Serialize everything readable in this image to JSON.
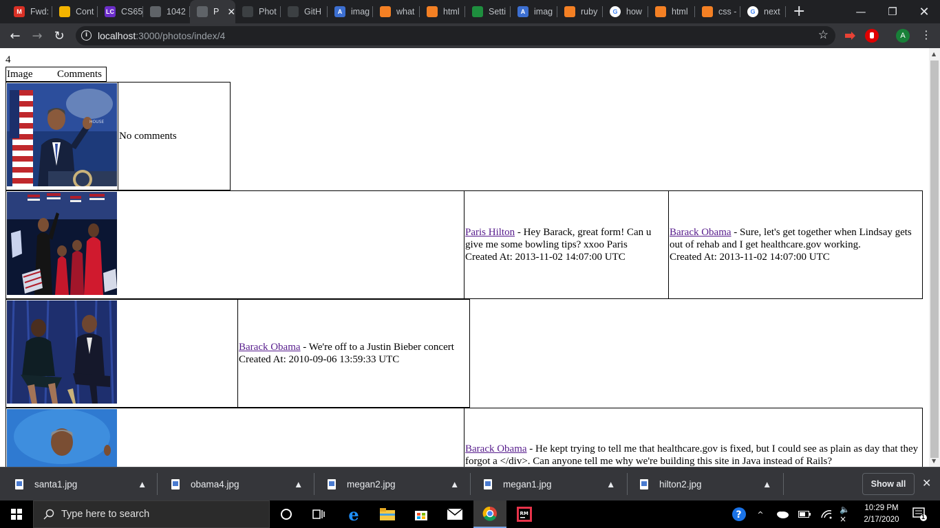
{
  "browser": {
    "tabs": [
      {
        "title": "Fwd:",
        "icon": "gmail-icon",
        "color": "#d93025",
        "glyph": "M",
        "active": false
      },
      {
        "title": "Cont",
        "icon": "doc-icon",
        "color": "#f4b400",
        "glyph": "",
        "active": false
      },
      {
        "title": "CS65",
        "icon": "lc-icon",
        "color": "#6b2dc9",
        "glyph": "LC",
        "active": false
      },
      {
        "title": "1042",
        "icon": "globe-icon",
        "color": "#5f6368",
        "glyph": "",
        "active": false
      },
      {
        "title": "P",
        "icon": "globe-icon",
        "color": "#5f6368",
        "glyph": "",
        "active": true
      },
      {
        "title": "Phot",
        "icon": "github-icon",
        "color": "#3c4043",
        "glyph": "",
        "active": false
      },
      {
        "title": "GitH",
        "icon": "github-icon",
        "color": "#3c4043",
        "glyph": "",
        "active": false
      },
      {
        "title": "imag",
        "icon": "a-icon",
        "color": "#3c6fd1",
        "glyph": "A",
        "active": false
      },
      {
        "title": "what",
        "icon": "stackoverflow-icon",
        "color": "#f48024",
        "glyph": "",
        "active": false
      },
      {
        "title": "html",
        "icon": "stackoverflow-icon",
        "color": "#f48024",
        "glyph": "",
        "active": false
      },
      {
        "title": "Setti",
        "icon": "settings-icon",
        "color": "#1e8e3e",
        "glyph": "",
        "active": false
      },
      {
        "title": "imag",
        "icon": "a-icon",
        "color": "#3c6fd1",
        "glyph": "A",
        "active": false
      },
      {
        "title": "ruby",
        "icon": "stackoverflow-icon",
        "color": "#f48024",
        "glyph": "",
        "active": false
      },
      {
        "title": "how",
        "icon": "google-icon",
        "color": "#ffffff",
        "glyph": "G",
        "active": false
      },
      {
        "title": "html",
        "icon": "stackoverflow-icon",
        "color": "#f48024",
        "glyph": "",
        "active": false
      },
      {
        "title": "css -",
        "icon": "stackoverflow-icon",
        "color": "#f48024",
        "glyph": "",
        "active": false
      },
      {
        "title": "next",
        "icon": "google-icon",
        "color": "#ffffff",
        "glyph": "G",
        "active": false
      }
    ],
    "url_host": "localhost",
    "url_path": ":3000/photos/index/4",
    "profile_initial": "A"
  },
  "page": {
    "photo_id": "4",
    "headers": {
      "image": "Image",
      "comments": "Comments"
    },
    "no_comments": "No comments",
    "rows": [
      {
        "image": "photo-obama-podium",
        "comments": []
      },
      {
        "image": "photo-obama-family-stage",
        "comments": [
          {
            "author": "Paris Hilton",
            "text": " - Hey Barack, great form! Can u give me some bowling tips? xxoo Paris",
            "created": "Created At: 2013-11-02 14:07:00 UTC"
          },
          {
            "author": "Barack Obama",
            "text": " - Sure, let's get together when Lindsay gets out of rehab and I get healthcare.gov working.",
            "created": "Created At: 2013-11-02 14:07:00 UTC"
          }
        ]
      },
      {
        "image": "photo-obamas-seated",
        "comments": [
          {
            "author": "Barack Obama",
            "text": " - We're off to a Justin Bieber concert",
            "created": "Created At: 2010-09-06 13:59:33 UTC"
          }
        ]
      },
      {
        "image": "photo-obama-portrait",
        "comments": [
          {
            "author": "Barack Obama",
            "text": " - He kept trying to tell me that healthcare.gov is fixed, but I could see as plain as day that they forgot a </div>. Can anyone tell me why we're building this site in Java instead of Rails?",
            "created": ""
          }
        ]
      }
    ]
  },
  "downloads": {
    "items": [
      "santa1.jpg",
      "obama4.jpg",
      "megan2.jpg",
      "megan1.jpg",
      "hilton2.jpg"
    ],
    "show_all": "Show all"
  },
  "taskbar": {
    "search_placeholder": "Type here to search",
    "time": "10:29 PM",
    "date": "2/17/2020",
    "notification_count": "1"
  }
}
